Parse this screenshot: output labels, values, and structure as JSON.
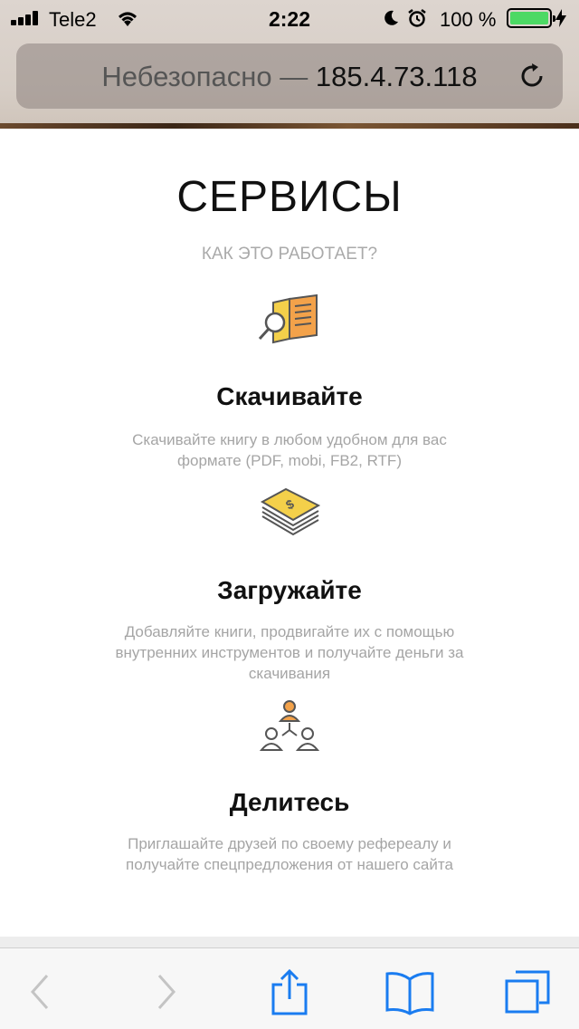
{
  "status_bar": {
    "carrier": "Tele2",
    "time": "2:22",
    "battery_percent": "100 %"
  },
  "url_bar": {
    "security_label": "Небезопасно",
    "separator": " — ",
    "host": "185.4.73.118"
  },
  "page": {
    "title": "СЕРВИСЫ",
    "subtitle": "КАК ЭТО РАБОТАЕТ?",
    "services": [
      {
        "icon": "book-search-icon",
        "name": "Скачивайте",
        "description": "Скачивайте книгу в любом удобном для вас формате (PDF, mobi, FB2, RTF)"
      },
      {
        "icon": "money-stack-icon",
        "name": "Загружайте",
        "description": "Добавляйте книги, продвигайте их с помощью внутренних инструментов и получайте деньги за скачивания"
      },
      {
        "icon": "referral-network-icon",
        "name": "Делитесь",
        "description": "Приглашайте друзей по своему рефереалу и получайте спецпредложения от нашего сайта"
      }
    ]
  },
  "toolbar": {
    "icons": [
      "back-arrow-icon",
      "forward-arrow-icon",
      "share-icon",
      "bookmarks-icon",
      "tabs-icon"
    ]
  },
  "colors": {
    "accent": "#1a7cf0",
    "battery": "#4cd964",
    "icon_orange": "#e8903a",
    "icon_yellow": "#f4d04a"
  }
}
